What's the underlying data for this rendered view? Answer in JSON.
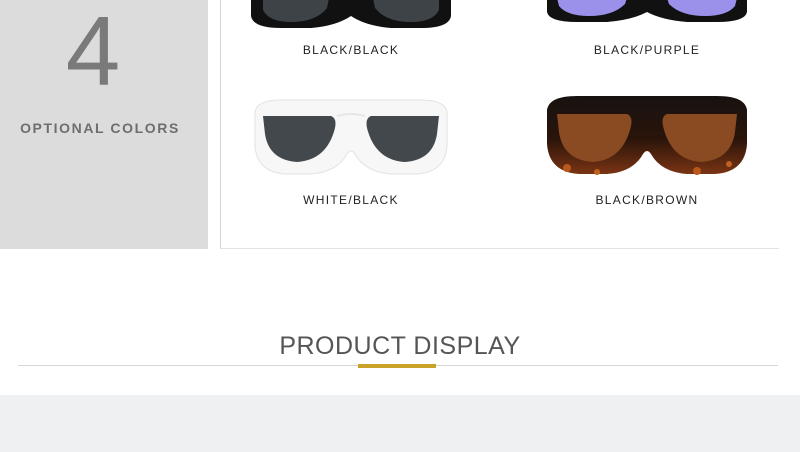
{
  "sidebar": {
    "number": "4",
    "label": "OPTIONAL COLORS"
  },
  "colors": [
    {
      "name": "BLACK/BLACK",
      "frame": "#111111",
      "lens": "#3e4347"
    },
    {
      "name": "BLACK/PURPLE",
      "frame": "#111111",
      "lens": "#9b90ea"
    },
    {
      "name": "WHITE/BLACK",
      "frame": "#f7f7f7",
      "lens": "#43484c"
    },
    {
      "name": "BLACK/BROWN",
      "frame": "#161210",
      "lens": "#8a4a22"
    }
  ],
  "section": {
    "title": "PRODUCT DISPLAY",
    "accent": "#c9a227"
  }
}
